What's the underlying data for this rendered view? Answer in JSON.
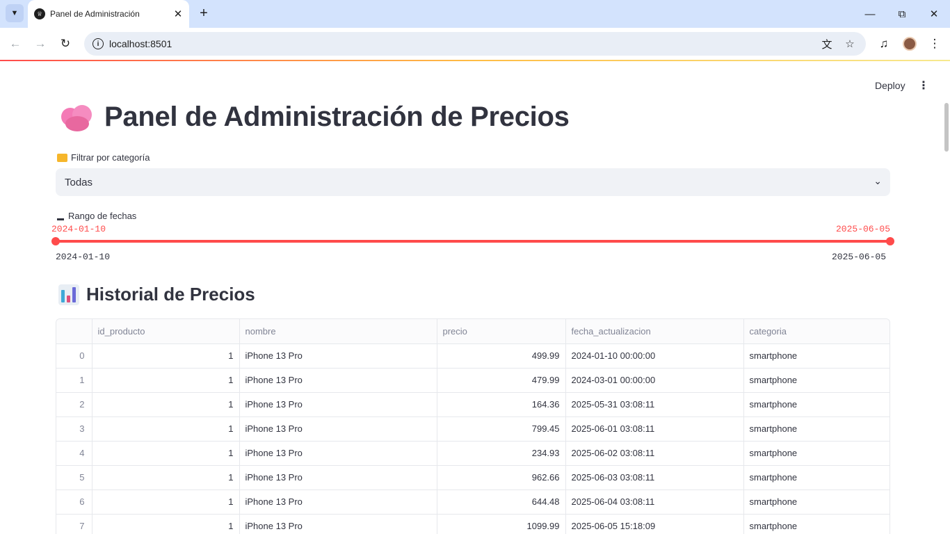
{
  "browser": {
    "tab_title": "Panel de Administración",
    "url": "localhost:8501"
  },
  "app": {
    "deploy_label": "Deploy",
    "title": "Panel de Administración de Precios",
    "filter": {
      "label": "Filtrar por categoría",
      "value": "Todas"
    },
    "date_range": {
      "label": "Rango de fechas",
      "selected_start": "2024-01-10",
      "selected_end": "2025-06-05",
      "min": "2024-01-10",
      "max": "2025-06-05"
    },
    "section_title": "Historial de Precios",
    "table": {
      "columns": [
        "",
        "id_producto",
        "nombre",
        "precio",
        "fecha_actualizacion",
        "categoria"
      ],
      "rows": [
        {
          "index": "0",
          "id_producto": "1",
          "nombre": "iPhone 13 Pro",
          "precio": "499.99",
          "fecha": "2024-01-10 00:00:00",
          "categoria": "smartphone"
        },
        {
          "index": "1",
          "id_producto": "1",
          "nombre": "iPhone 13 Pro",
          "precio": "479.99",
          "fecha": "2024-03-01 00:00:00",
          "categoria": "smartphone"
        },
        {
          "index": "2",
          "id_producto": "1",
          "nombre": "iPhone 13 Pro",
          "precio": "164.36",
          "fecha": "2025-05-31 03:08:11",
          "categoria": "smartphone"
        },
        {
          "index": "3",
          "id_producto": "1",
          "nombre": "iPhone 13 Pro",
          "precio": "799.45",
          "fecha": "2025-06-01 03:08:11",
          "categoria": "smartphone"
        },
        {
          "index": "4",
          "id_producto": "1",
          "nombre": "iPhone 13 Pro",
          "precio": "234.93",
          "fecha": "2025-06-02 03:08:11",
          "categoria": "smartphone"
        },
        {
          "index": "5",
          "id_producto": "1",
          "nombre": "iPhone 13 Pro",
          "precio": "962.66",
          "fecha": "2025-06-03 03:08:11",
          "categoria": "smartphone"
        },
        {
          "index": "6",
          "id_producto": "1",
          "nombre": "iPhone 13 Pro",
          "precio": "644.48",
          "fecha": "2025-06-04 03:08:11",
          "categoria": "smartphone"
        },
        {
          "index": "7",
          "id_producto": "1",
          "nombre": "iPhone 13 Pro",
          "precio": "1099.99",
          "fecha": "2025-06-05 15:18:09",
          "categoria": "smartphone"
        }
      ]
    }
  },
  "colors": {
    "accent": "#ff4b4b",
    "text": "#31333f",
    "tabbar": "#d3e3fd"
  }
}
